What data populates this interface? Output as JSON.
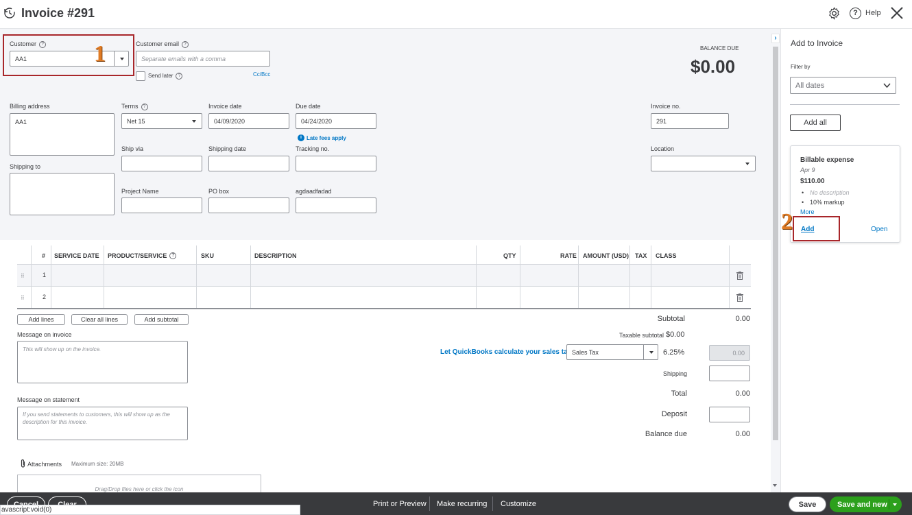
{
  "header": {
    "title": "Invoice #291",
    "help_label": "Help"
  },
  "customer": {
    "label": "Customer",
    "value": "AA1"
  },
  "customer_email": {
    "label": "Customer email",
    "placeholder": "Separate emails with a comma",
    "send_later": "Send later",
    "cc_bcc": "Cc/Bcc"
  },
  "balance": {
    "label": "BALANCE DUE",
    "value": "$0.00"
  },
  "billing_address": {
    "label": "Billing address",
    "value": "AA1"
  },
  "shipping_to": {
    "label": "Shipping to"
  },
  "terms": {
    "label": "Terms",
    "value": "Net 15"
  },
  "invoice_date": {
    "label": "Invoice date",
    "value": "04/09/2020"
  },
  "due_date": {
    "label": "Due date",
    "value": "04/24/2020",
    "late_fees": "Late fees apply"
  },
  "invoice_no": {
    "label": "Invoice no.",
    "value": "291"
  },
  "ship_via": {
    "label": "Ship via"
  },
  "shipping_date": {
    "label": "Shipping date"
  },
  "tracking_no": {
    "label": "Tracking no."
  },
  "location": {
    "label": "Location"
  },
  "project_name": {
    "label": "Project Name"
  },
  "po_box": {
    "label": "PO box"
  },
  "custom_field": {
    "label": "agdaadfadad"
  },
  "table": {
    "headers": [
      "#",
      "SERVICE DATE",
      "PRODUCT/SERVICE",
      "SKU",
      "DESCRIPTION",
      "QTY",
      "RATE",
      "AMOUNT (USD)",
      "TAX",
      "CLASS"
    ],
    "rows": [
      {
        "num": "1"
      },
      {
        "num": "2"
      }
    ]
  },
  "table_buttons": {
    "add_lines": "Add lines",
    "clear_all_lines": "Clear all lines",
    "add_subtotal": "Add subtotal"
  },
  "message_invoice": {
    "label": "Message on invoice",
    "placeholder": "This will show up on the invoice."
  },
  "message_statement": {
    "label": "Message on statement",
    "placeholder": "If you send statements to customers, this will show up as the description for this invoice."
  },
  "attachments": {
    "label": "Attachments",
    "max_size": "Maximum size: 20MB",
    "dropzone": "Drag/Drop files here or click the icon"
  },
  "totals": {
    "subtotal_label": "Subtotal",
    "subtotal_value": "0.00",
    "taxable_label": "Taxable subtotal",
    "taxable_value": "$0.00",
    "tax_link": "Let QuickBooks calculate your sales tax",
    "tax_select": "Sales Tax",
    "tax_rate": "6.25%",
    "tax_amount": "0.00",
    "shipping_label": "Shipping",
    "total_label": "Total",
    "total_value": "0.00",
    "deposit_label": "Deposit",
    "balance_due_label": "Balance due",
    "balance_due_value": "0.00"
  },
  "sidebar": {
    "title": "Add to Invoice",
    "filter_label": "Filter by",
    "filter_value": "All dates",
    "add_all": "Add all",
    "card": {
      "title": "Billable expense",
      "date": "Apr 9",
      "amount": "$110.00",
      "bullet1": "No description",
      "bullet2": "10% markup",
      "more": "More",
      "add": "Add",
      "open": "Open"
    }
  },
  "footer": {
    "cancel": "Cancel",
    "clear": "Clear",
    "status": "avascript:void(0)",
    "print": "Print or Preview",
    "recurring": "Make recurring",
    "customize": "Customize",
    "save": "Save",
    "save_new": "Save and new"
  },
  "annotations": {
    "badge1": "1",
    "badge2": "2"
  },
  "colors": {
    "accent": "#0077c5",
    "green": "#2ca01c",
    "annotation": "#a8262a",
    "badge": "#e07b24"
  }
}
